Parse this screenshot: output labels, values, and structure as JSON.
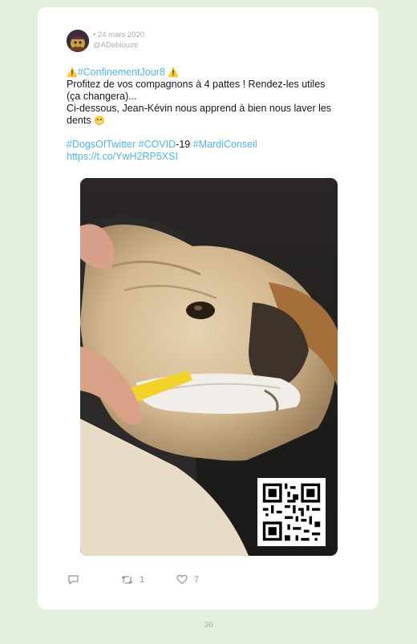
{
  "tweet": {
    "date": "• 24 mars 2020",
    "handle": "@ADeblouze",
    "text": {
      "warning_emoji": "⚠️",
      "hashtag_confinement": "#ConfinementJour8",
      "line1": "Profitez de vos compagnons à 4 pattes ! Rendez-les utiles",
      "line2": "(ça changera)...",
      "line3": "Ci-dessous, Jean-Kévin nous apprend à bien nous laver les",
      "line4_text": "dents",
      "grin_emoji": "😬",
      "hashtag_dogs": "#DogsOfTwitter",
      "hashtag_covid": "#COVID",
      "covid_suffix": "-19",
      "hashtag_mardi": "#MardiConseil",
      "url": "https://t.co/YwH2RP5XSI"
    },
    "media": {
      "description_icon": "dog-brushing-teeth-photo",
      "qr_icon": "qr-code-icon"
    },
    "actions": {
      "reply_icon": "reply-icon",
      "retweet_icon": "retweet-icon",
      "retweet_count": "1",
      "like_icon": "heart-icon",
      "like_count": "7"
    }
  },
  "page": {
    "number": "36"
  },
  "colors": {
    "background": "#e3eedd",
    "card": "#ffffff",
    "link": "#4fb4ec",
    "muted": "#a6adb3"
  }
}
